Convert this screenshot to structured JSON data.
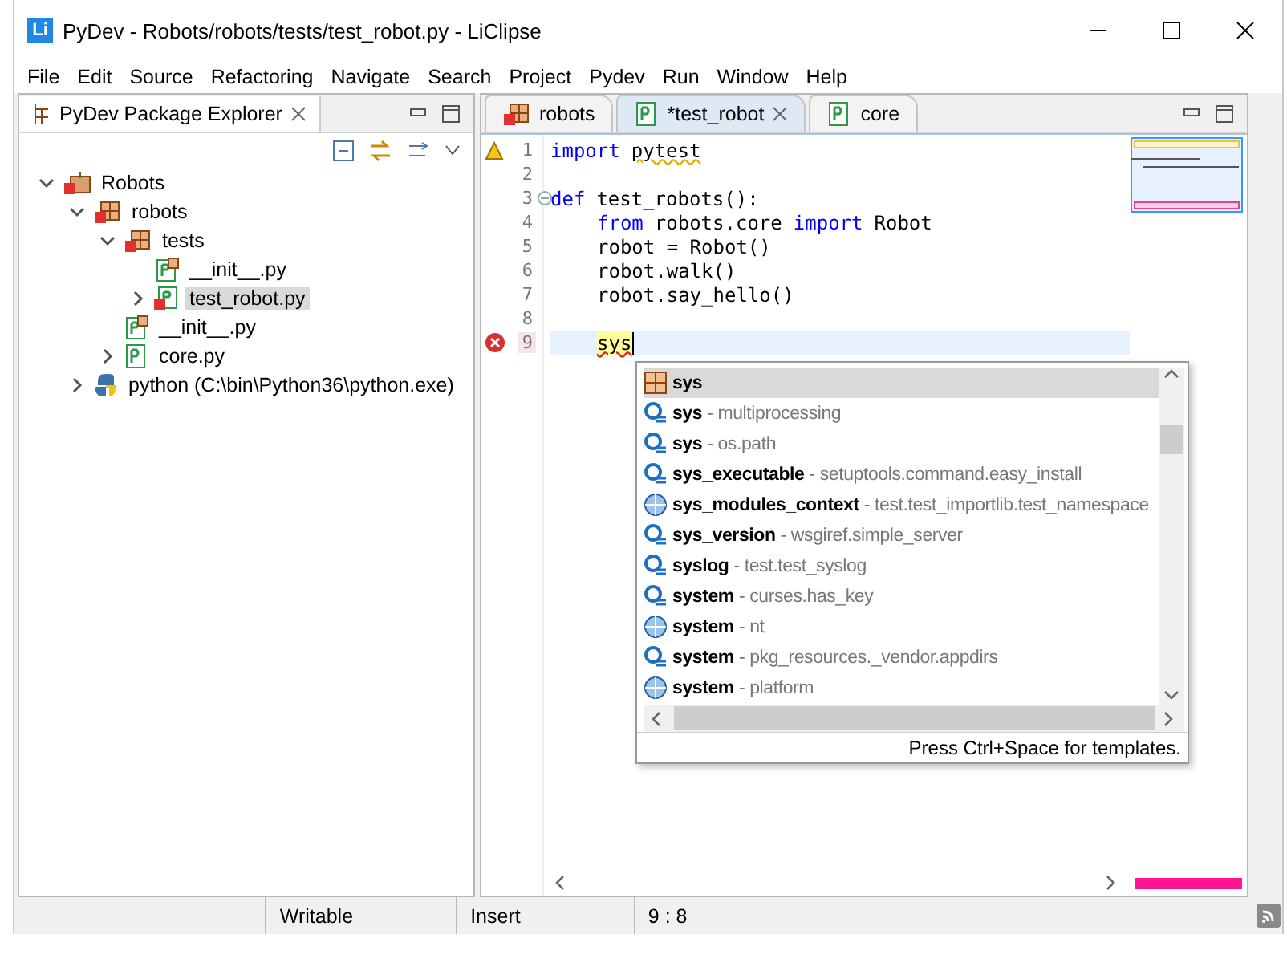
{
  "window": {
    "title": "PyDev - Robots/robots/tests/test_robot.py - LiClipse",
    "app_icon": "Li"
  },
  "menu": [
    "File",
    "Edit",
    "Source",
    "Refactoring",
    "Navigate",
    "Search",
    "Project",
    "Pydev",
    "Run",
    "Window",
    "Help"
  ],
  "explorer": {
    "title": "PyDev Package Explorer",
    "tree": [
      {
        "label": "Robots",
        "kind": "project",
        "expanded": true,
        "selected": false,
        "children": [
          {
            "label": "robots",
            "kind": "package",
            "expanded": true,
            "selected": false,
            "children": [
              {
                "label": "tests",
                "kind": "package",
                "expanded": true,
                "selected": false,
                "children": [
                  {
                    "label": "__init__.py",
                    "kind": "init",
                    "selected": false
                  },
                  {
                    "label": "test_robot.py",
                    "kind": "error-file",
                    "expanded": false,
                    "selected": true
                  }
                ]
              },
              {
                "label": "__init__.py",
                "kind": "init",
                "selected": false
              },
              {
                "label": "core.py",
                "kind": "file",
                "expanded": false,
                "selected": false
              }
            ]
          },
          {
            "label": "python  (C:\\bin\\Python36\\python.exe)",
            "kind": "python",
            "expanded": false,
            "selected": false
          }
        ]
      }
    ]
  },
  "editor": {
    "tabs": [
      {
        "label": "robots",
        "kind": "package",
        "selected": false,
        "closable": false
      },
      {
        "label": "*test_robot",
        "kind": "file",
        "selected": true,
        "closable": true
      },
      {
        "label": "core",
        "kind": "file",
        "selected": false,
        "closable": false
      }
    ],
    "lines": [
      {
        "number": "1",
        "kind": "warning",
        "segments": [
          {
            "text": "import",
            "kind": "keyword"
          },
          {
            "text": "pytest",
            "kind": "warning"
          }
        ]
      },
      {
        "number": "2",
        "kind": "plain"
      },
      {
        "number": "3",
        "kind": "fold",
        "segments": [
          {
            "text": "def",
            "kind": "keyword"
          },
          {
            "text": "test_robots():",
            "kind": "plain"
          }
        ]
      },
      {
        "number": "4",
        "kind": "plain",
        "indented": true,
        "segments": [
          {
            "text": "from",
            "kind": "keyword"
          },
          {
            "text": "robots.core",
            "kind": "plain"
          },
          {
            "text": "import",
            "kind": "keyword"
          },
          {
            "text": "Robot",
            "kind": "plain"
          }
        ]
      },
      {
        "number": "5",
        "kind": "plain",
        "indented": true,
        "segments": [
          {
            "text": "robot = Robot()",
            "kind": "plain"
          }
        ]
      },
      {
        "number": "6",
        "kind": "plain",
        "indented": true,
        "segments": [
          {
            "text": "robot.walk()",
            "kind": "plain"
          }
        ]
      },
      {
        "number": "7",
        "kind": "plain",
        "indented": true,
        "segments": [
          {
            "text": "robot.say_hello()",
            "kind": "plain"
          }
        ]
      },
      {
        "number": "8",
        "kind": "plain"
      },
      {
        "number": "9",
        "kind": "error",
        "current": true,
        "indented": true,
        "segments": [
          {
            "text": "sys",
            "kind": "error"
          }
        ]
      }
    ],
    "completions": [
      {
        "name": "sys",
        "kind": "package",
        "selected": true
      },
      {
        "name": "sys",
        "module": "- multiprocessing",
        "kind": "module",
        "selected": false
      },
      {
        "name": "sys",
        "module": "- os.path",
        "kind": "module",
        "selected": false
      },
      {
        "name": "sys_executable",
        "module": "- setuptools.command.easy_install",
        "kind": "module",
        "selected": false
      },
      {
        "name": "sys_modules_context",
        "module": "- test.test_importlib.test_namespace",
        "kind": "global",
        "selected": false
      },
      {
        "name": "sys_version",
        "module": "- wsgiref.simple_server",
        "kind": "module",
        "selected": false
      },
      {
        "name": "syslog",
        "module": "- test.test_syslog",
        "kind": "module",
        "selected": false
      },
      {
        "name": "system",
        "module": "- curses.has_key",
        "kind": "module",
        "selected": false
      },
      {
        "name": "system",
        "module": "- nt",
        "kind": "global",
        "selected": false
      },
      {
        "name": "system",
        "module": "- pkg_resources._vendor.appdirs",
        "kind": "module",
        "selected": false
      },
      {
        "name": "system",
        "module": "- platform",
        "kind": "global",
        "selected": false
      }
    ],
    "completion_hint": "Press Ctrl+Space for templates."
  },
  "status_bar": [
    "Writable",
    "Insert",
    "9 : 8"
  ]
}
